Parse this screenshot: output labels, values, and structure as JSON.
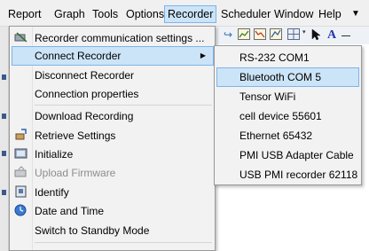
{
  "menubar": {
    "items": [
      {
        "label": "Report"
      },
      {
        "label": "Graph"
      },
      {
        "label": "Tools"
      },
      {
        "label": "Options"
      },
      {
        "label": "Recorder"
      },
      {
        "label": "Scheduler"
      },
      {
        "label": "Window"
      },
      {
        "label": "Help"
      }
    ],
    "overflow_glyph": "▼",
    "active_item": "Recorder"
  },
  "toolbar": {
    "icons": [
      "toolbar-arrow-icon",
      "toolbar-chart-icon",
      "toolbar-chart-down-icon",
      "toolbar-chart-up-icon",
      "toolbar-grid-icon",
      "pointer-icon",
      "text-tool-icon"
    ],
    "text_tool_glyph": "A",
    "dropdown_glyph": "▾"
  },
  "recorder_menu": {
    "items": [
      {
        "label": "Recorder communication settings ...",
        "icon": "recorder-settings-icon",
        "state": "normal"
      },
      {
        "label": "Connect Recorder",
        "icon": "",
        "state": "highlighted",
        "submenu": true
      },
      {
        "label": "Disconnect Recorder",
        "icon": "",
        "state": "normal"
      },
      {
        "label": "Connection properties",
        "icon": "",
        "state": "normal"
      },
      {
        "label": "Download Recording",
        "icon": "",
        "state": "normal"
      },
      {
        "label": "Retrieve Settings",
        "icon": "retrieve-settings-icon",
        "state": "normal"
      },
      {
        "label": "Initialize",
        "icon": "initialize-icon",
        "state": "normal"
      },
      {
        "label": "Upload Firmware",
        "icon": "upload-firmware-icon",
        "state": "disabled"
      },
      {
        "label": "Identify",
        "icon": "identify-icon",
        "state": "normal"
      },
      {
        "label": "Date and Time",
        "icon": "clock-icon",
        "state": "normal"
      },
      {
        "label": "Switch to Standby Mode",
        "icon": "",
        "state": "normal"
      }
    ],
    "submenu_arrow": "▶"
  },
  "connect_submenu": {
    "items": [
      {
        "label": "RS-232 COM1",
        "state": "normal"
      },
      {
        "label": "Bluetooth COM 5",
        "state": "highlighted"
      },
      {
        "label": "Tensor WiFi",
        "state": "normal"
      },
      {
        "label": "cell device 55601",
        "state": "normal"
      },
      {
        "label": "Ethernet 65432",
        "state": "normal"
      },
      {
        "label": "PMI USB Adapter Cable",
        "state": "normal"
      },
      {
        "label": "USB PMI recorder 62118",
        "state": "normal"
      }
    ]
  }
}
